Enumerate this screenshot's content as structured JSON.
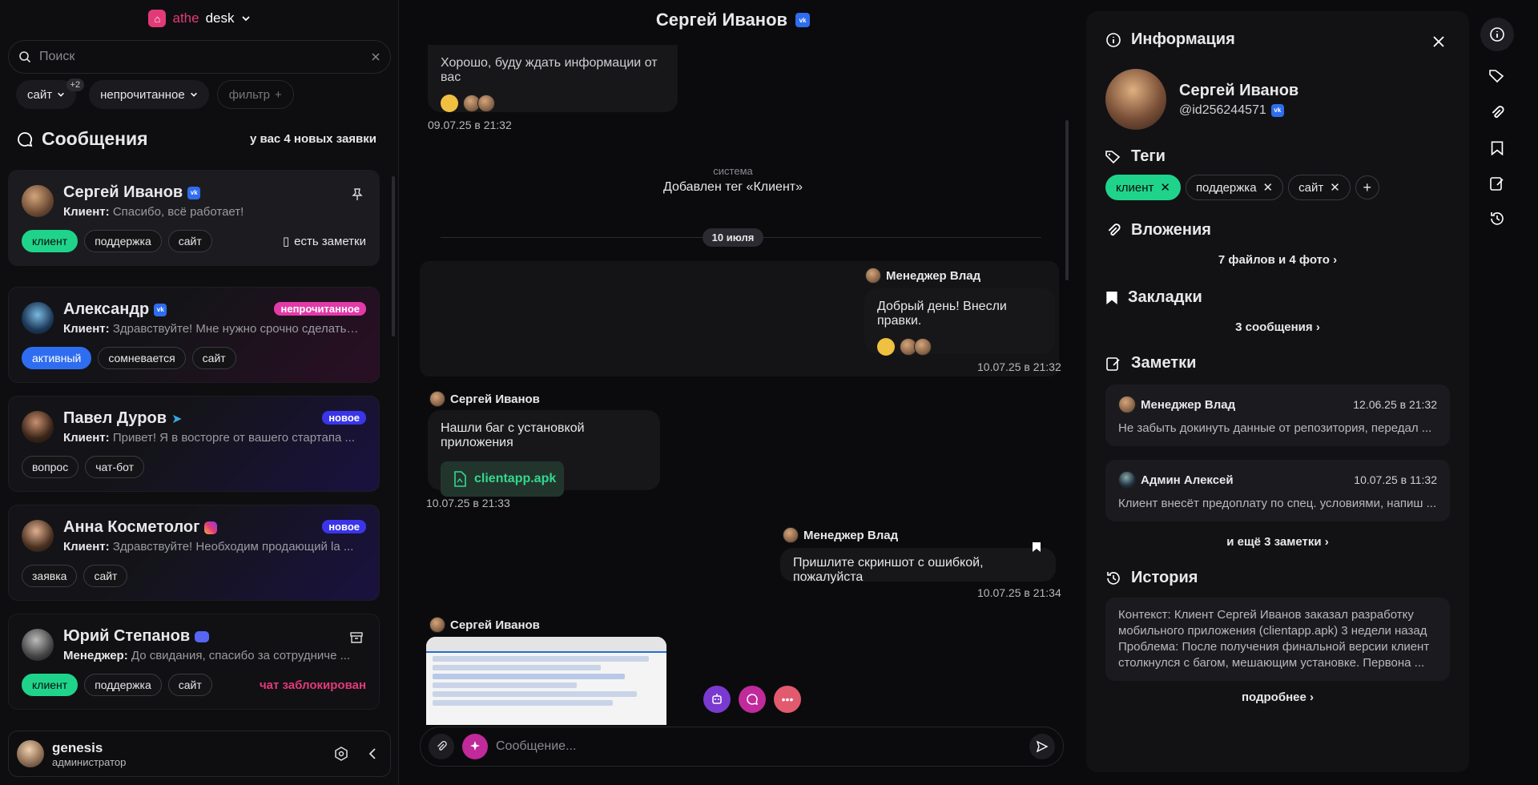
{
  "brand": {
    "a": "athe",
    "b": "desk"
  },
  "search": {
    "placeholder": "Поиск"
  },
  "filters": {
    "site": "сайт",
    "site_badge": "+2",
    "unread": "непрочитанное",
    "filter": "фильтр"
  },
  "messages": {
    "title": "Сообщения",
    "requests": "у вас 4 новых заявки"
  },
  "conversations": [
    {
      "name": "Сергей Иванов",
      "role": "Клиент:",
      "preview": "Спасибо, всё работает!",
      "tags": [
        "клиент",
        "поддержка",
        "сайт"
      ],
      "note": "есть заметки"
    },
    {
      "name": "Александр",
      "role": "Клиент:",
      "preview": "Здравствуйте! Мне нужно срочно сделать ...",
      "tags": [
        "активный",
        "сомневается",
        "сайт"
      ],
      "pill": "непрочитанное"
    },
    {
      "name": "Павел Дуров",
      "role": "Клиент:",
      "preview": "Привет! Я в восторге от вашего стартапа ...",
      "tags": [
        "вопрос",
        "чат-бот"
      ],
      "pill": "новое"
    },
    {
      "name": "Анна Косметолог",
      "role": "Клиент:",
      "preview": "Здравствуйте! Необходим продающий la ...",
      "tags": [
        "заявка",
        "сайт"
      ],
      "pill": "новое"
    },
    {
      "name": "Юрий Степанов",
      "role": "Менеджер:",
      "preview": "До свидания, спасибо за сотрудниче ...",
      "tags": [
        "клиент",
        "поддержка",
        "сайт"
      ],
      "status": "чат заблокирован"
    }
  ],
  "user": {
    "name": "genesis",
    "role": "администратор"
  },
  "chat": {
    "title": "Сергей Иванов",
    "m1": {
      "text": "Хорошо, буду ждать информации от вас",
      "time": "09.07.25 в 21:32"
    },
    "system": {
      "label": "система",
      "text": "Добавлен тег «Клиент»"
    },
    "date": "10 июля",
    "m2": {
      "sender": "Менеджер Влад",
      "text": "Добрый день! Внесли правки.",
      "time": "10.07.25 в 21:32"
    },
    "m3": {
      "sender": "Сергей Иванов",
      "text": "Нашли баг с установкой приложения",
      "file": "clientapp.apk",
      "time": "10.07.25 в 21:33"
    },
    "m4": {
      "sender": "Менеджер Влад",
      "text": "Пришлите скриншот с ошибкой, пожалуйста",
      "time": "10.07.25 в 21:34"
    },
    "m5": {
      "sender": "Сергей Иванов"
    },
    "composer_placeholder": "Сообщение..."
  },
  "info": {
    "title": "Информация",
    "name": "Сергей Иванов",
    "handle": "@id256244571",
    "tags_title": "Теги",
    "tags": [
      "клиент",
      "поддержка",
      "сайт"
    ],
    "attachments_title": "Вложения",
    "attachments_link": "7 файлов и 4 фото",
    "bookmarks_title": "Закладки",
    "bookmarks_link": "3 сообщения",
    "notes_title": "Заметки",
    "notes": [
      {
        "author": "Менеджер Влад",
        "date": "12.06.25 в 21:32",
        "text": "Не забыть докинуть данные от репозитория, передал ..."
      },
      {
        "author": "Админ Алексей",
        "date": "10.07.25 в 11:32",
        "text": "Клиент внесёт предоплату по спец. условиями, напиш ..."
      }
    ],
    "notes_more": "и ещё 3 заметки",
    "history_title": "История",
    "history_text": "Контекст: Клиент Сергей Иванов заказал разработку мобильного приложения (clientapp.apk) 3 недели назад Проблема: После получения финальной версии клиент столкнулся с багом, мешающим установке. Первона ...",
    "history_more": "подробнее"
  },
  "colors": {
    "accent": "#1fd48a",
    "brand": "#e23a78",
    "vk": "#2f6df0",
    "pink_pill": "#e23aa8",
    "indigo_pill": "#3a35e8"
  }
}
